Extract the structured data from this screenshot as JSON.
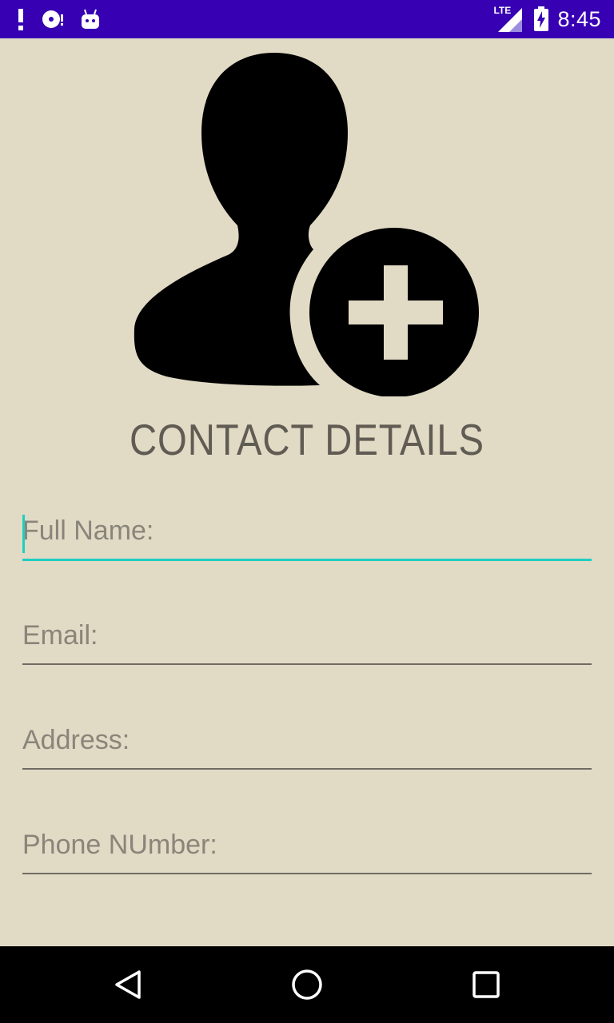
{
  "status_bar": {
    "time": "8:45",
    "network": "LTE",
    "colors": {
      "background": "#3700b3"
    },
    "icons": [
      "notification-alert-icon",
      "sync-disc-icon",
      "android-icon",
      "lte-signal-icon",
      "battery-charging-icon"
    ]
  },
  "header": {
    "title": "CONTACT DETAILS",
    "icon": "add-contact-icon"
  },
  "form": {
    "fields": [
      {
        "name": "full-name",
        "placeholder": "Full Name:",
        "value": "",
        "focused": true
      },
      {
        "name": "email",
        "placeholder": "Email:",
        "value": "",
        "focused": false
      },
      {
        "name": "address",
        "placeholder": "Address:",
        "value": "",
        "focused": false
      },
      {
        "name": "phone-number",
        "placeholder": "Phone NUmber:",
        "value": "",
        "focused": false
      }
    ]
  },
  "nav_bar": {
    "icons": [
      "back-icon",
      "home-icon",
      "recents-icon"
    ]
  },
  "colors": {
    "background": "#e1dac5",
    "accent": "#1ecfc0",
    "title": "#605c53"
  }
}
